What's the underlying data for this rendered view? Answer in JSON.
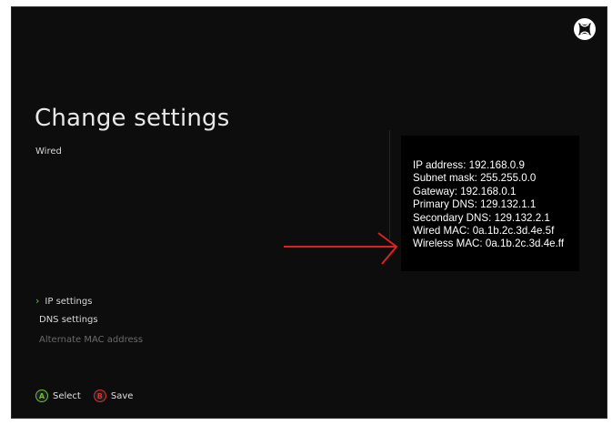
{
  "screen": {
    "title": "Change settings",
    "subtitle": "Wired"
  },
  "menu": {
    "items": [
      {
        "label": "IP settings",
        "selected": true,
        "enabled": true
      },
      {
        "label": "DNS settings",
        "selected": false,
        "enabled": true
      },
      {
        "label": "Alternate MAC address",
        "selected": false,
        "enabled": false
      }
    ]
  },
  "footer": {
    "select_key": "A",
    "select_label": "Select",
    "save_key": "B",
    "save_label": "Save"
  },
  "info": {
    "lines": [
      "IP address: 192.168.0.9",
      "Subnet mask: 255.255.0.0",
      "Gateway: 192.168.0.1",
      "Primary DNS: 129.132.1.1",
      "Secondary DNS: 129.132.2.1",
      "Wired MAC: 0a.1b.2c.3d.4e.5f",
      "Wireless MAC: 0a.1b.2c.3d.4e.ff"
    ]
  },
  "colors": {
    "background": "#0d0d0d",
    "accent_green": "#6dbf3a",
    "accent_red": "#d9312b",
    "arrow": "#e02020"
  },
  "icons": {
    "logo": "xbox-logo-icon",
    "chevron": "chevron-right-icon",
    "arrow": "arrow-right-icon"
  }
}
